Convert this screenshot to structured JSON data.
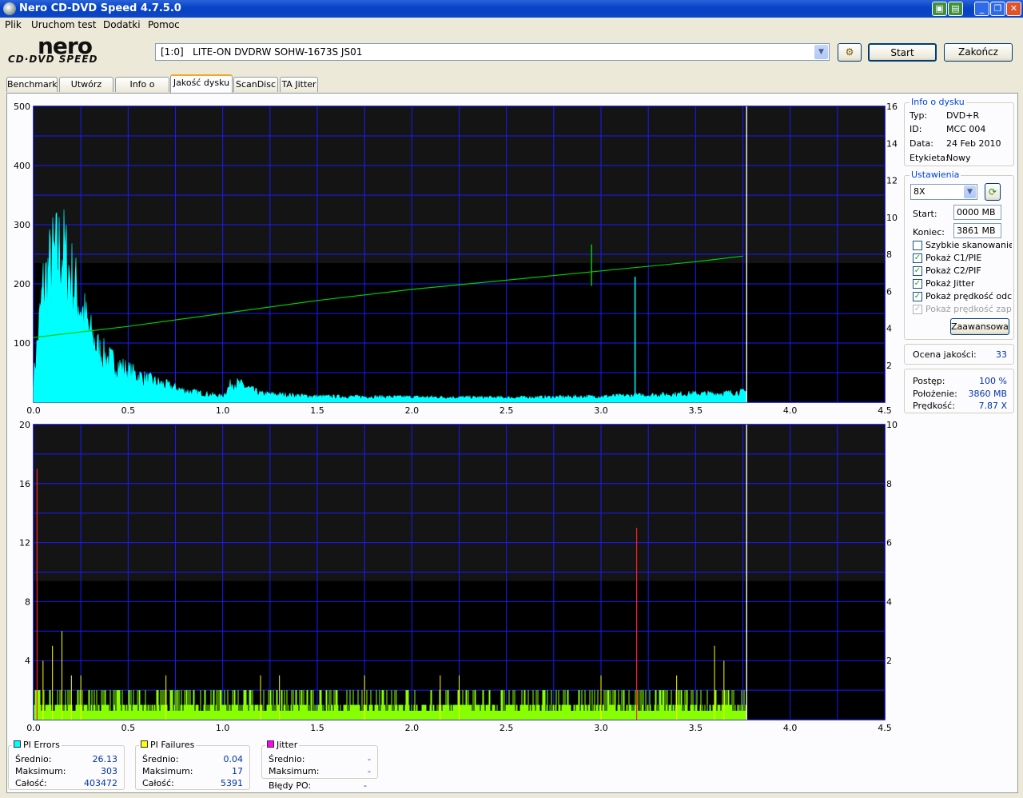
{
  "window": {
    "title": "Nero CD-DVD Speed 4.7.5.0",
    "controls": [
      "min",
      "max",
      "close"
    ]
  },
  "menu": [
    "Plik",
    "Uruchom test",
    "Dodatki",
    "Pomoc"
  ],
  "logo": {
    "main": "nero",
    "sub": "CD·DVD SPEED"
  },
  "drive": {
    "selected": "[1:0]   LITE-ON DVDRW SOHW-1673S JS01"
  },
  "buttons": {
    "start": "Start",
    "exit": "Zakończ",
    "advanced": "Zaawansowane"
  },
  "tabs": [
    "Benchmark",
    "Utwórz dysk",
    "Info o dysku",
    "Jakość dysku",
    "ScanDisc",
    "TA Jitter"
  ],
  "active_tab": 3,
  "disc_info": {
    "title": "Info o dysku",
    "type_label": "Typ:",
    "type": "DVD+R",
    "id_label": "ID:",
    "id": "MCC 004",
    "date_label": "Data:",
    "date": "24 Feb 2010",
    "label_label": "Etykieta:",
    "label": "Nowy"
  },
  "settings": {
    "title": "Ustawienia",
    "speed": "8X",
    "start_label": "Start:",
    "start": "0000 MB",
    "end_label": "Koniec:",
    "end": "3861 MB",
    "options": [
      {
        "label": "Szybkie skanowanie",
        "checked": false,
        "disabled": false
      },
      {
        "label": "Pokaż C1/PIE",
        "checked": true,
        "disabled": false
      },
      {
        "label": "Pokaż C2/PIF",
        "checked": true,
        "disabled": false
      },
      {
        "label": "Pokaż Jitter",
        "checked": true,
        "disabled": false
      },
      {
        "label": "Pokaż prędkość odczytu",
        "checked": true,
        "disabled": false
      },
      {
        "label": "Pokaż prędkość zapisu",
        "checked": true,
        "disabled": true
      }
    ]
  },
  "quality": {
    "label": "Ocena jakości:",
    "value": "33"
  },
  "progress": {
    "progress_label": "Postęp:",
    "progress": "100 %",
    "position_label": "Położenie:",
    "position": "3860 MB",
    "speed_label": "Prędkość:",
    "speed": "7.87 X"
  },
  "stats": {
    "pi_errors": {
      "title": "PI Errors",
      "avg_label": "Średnio:",
      "avg": "26.13",
      "max_label": "Maksimum:",
      "max": "303",
      "total_label": "Całość:",
      "total": "403472",
      "color": "#00ffff"
    },
    "pi_failures": {
      "title": "PI Failures",
      "avg_label": "Średnio:",
      "avg": "0.04",
      "max_label": "Maksimum:",
      "max": "17",
      "total_label": "Całość:",
      "total": "5391",
      "color": "#ffff00"
    },
    "jitter": {
      "title": "Jitter",
      "avg_label": "Średnio:",
      "avg": "-",
      "max_label": "Maksimum:",
      "max": "-",
      "po_label": "Błędy PO:",
      "po": "-",
      "color": "#ff00ff"
    }
  },
  "colors": {
    "pie": "#00ffff",
    "pif": "#88ff00",
    "pif_spike": "#ffff00",
    "speed_line": "#00cc00",
    "jitter_spike": "#ff2020",
    "chart_bg": "#000000",
    "grid": "#1a1aff"
  },
  "chart_data": [
    {
      "type": "area",
      "name": "PI Errors",
      "x_ticks": [
        "0.0",
        "0.5",
        "1.0",
        "1.5",
        "2.0",
        "2.5",
        "3.0",
        "3.5",
        "4.0",
        "4.5"
      ],
      "y_ticks_left": [
        "100",
        "200",
        "300",
        "400",
        "500"
      ],
      "y_ticks_right": [
        "2",
        "4",
        "6",
        "8",
        "10",
        "12",
        "14",
        "16"
      ],
      "xlim": [
        0,
        4.5
      ],
      "ylim_left": [
        0,
        500
      ],
      "ylim_right": [
        0,
        16
      ],
      "end_x": 3.77,
      "series": [
        {
          "name": "PI Errors",
          "x": [
            0.0,
            0.05,
            0.1,
            0.15,
            0.2,
            0.25,
            0.3,
            0.35,
            0.4,
            0.5,
            0.6,
            0.7,
            0.8,
            0.9,
            1.0,
            1.05,
            1.1,
            1.2,
            1.5,
            2.0,
            2.5,
            3.0,
            3.5,
            3.6,
            3.77
          ],
          "y": [
            40,
            200,
            250,
            270,
            220,
            170,
            120,
            90,
            75,
            55,
            40,
            30,
            20,
            15,
            10,
            35,
            30,
            15,
            10,
            9,
            8,
            10,
            15,
            15,
            18
          ]
        },
        {
          "name": "Read speed",
          "x": [
            0.0,
            0.5,
            1.0,
            1.5,
            2.0,
            2.5,
            3.0,
            3.5,
            3.75
          ],
          "y": [
            3.5,
            4.1,
            4.8,
            5.5,
            6.1,
            6.6,
            7.1,
            7.6,
            7.9
          ]
        }
      ],
      "annotations": [
        {
          "x": 2.95,
          "y": 8.1,
          "label": "speed spike"
        },
        {
          "x": 3.18,
          "y": 212,
          "label": "PIE spike"
        }
      ]
    },
    {
      "type": "bar",
      "name": "PI Failures",
      "x_ticks": [
        "0.0",
        "0.5",
        "1.0",
        "1.5",
        "2.0",
        "2.5",
        "3.0",
        "3.5",
        "4.0",
        "4.5"
      ],
      "y_ticks_left": [
        "4",
        "8",
        "12",
        "16",
        "20"
      ],
      "y_ticks_right": [
        "2",
        "4",
        "6",
        "8",
        "10"
      ],
      "xlim": [
        0,
        4.5
      ],
      "ylim_left": [
        0,
        20
      ],
      "ylim_right": [
        0,
        10
      ],
      "end_x": 3.77,
      "series": [
        {
          "name": "PI Failures",
          "baseline": 1,
          "typical_max": 2,
          "spikes_x": [
            0.05,
            0.1,
            0.15,
            0.2,
            0.25,
            0.7,
            1.2,
            1.3,
            1.75,
            2.15,
            2.25,
            3.0,
            3.4,
            3.6,
            3.65
          ],
          "spikes_y": [
            4,
            5,
            6,
            3,
            3,
            3,
            3,
            3,
            3,
            3,
            3,
            3,
            3,
            5,
            4
          ]
        },
        {
          "name": "Jitter spikes",
          "x": [
            0.01,
            3.18
          ],
          "y": [
            17,
            13
          ]
        }
      ]
    }
  ]
}
